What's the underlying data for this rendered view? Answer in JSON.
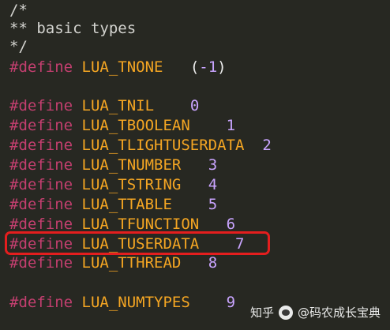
{
  "code": {
    "comment_lines": [
      "/*",
      "** basic types",
      "*/"
    ],
    "lines": [
      {
        "kw": "#define",
        "name": "LUA_TNONE",
        "value_open": "(",
        "value": "-1",
        "value_close": ")"
      },
      {
        "kw": "#define",
        "name": "LUA_TNIL",
        "value": "0"
      },
      {
        "kw": "#define",
        "name": "LUA_TBOOLEAN",
        "value": "1"
      },
      {
        "kw": "#define",
        "name": "LUA_TLIGHTUSERDATA",
        "value": "2"
      },
      {
        "kw": "#define",
        "name": "LUA_TNUMBER",
        "value": "3"
      },
      {
        "kw": "#define",
        "name": "LUA_TSTRING",
        "value": "4"
      },
      {
        "kw": "#define",
        "name": "LUA_TTABLE",
        "value": "5"
      },
      {
        "kw": "#define",
        "name": "LUA_TFUNCTION",
        "value": "6"
      },
      {
        "kw": "#define",
        "name": "LUA_TUSERDATA",
        "value": "7"
      },
      {
        "kw": "#define",
        "name": "LUA_TTHREAD",
        "value": "8"
      },
      {
        "kw": "#define",
        "name": "LUA_NUMTYPES",
        "value": "9"
      }
    ]
  },
  "highlight": {
    "target": "LUA_TUSERDATA",
    "color": "#e41e1e"
  },
  "watermark": {
    "site": "知乎",
    "author": "@码农成长宝典",
    "icon": "wechat-bubble-icon"
  },
  "colors": {
    "background": "#272822",
    "comment": "#d3d3cf",
    "keyword": "#c33f6f",
    "identifier": "#f5a623",
    "number": "#c9a4ff"
  }
}
